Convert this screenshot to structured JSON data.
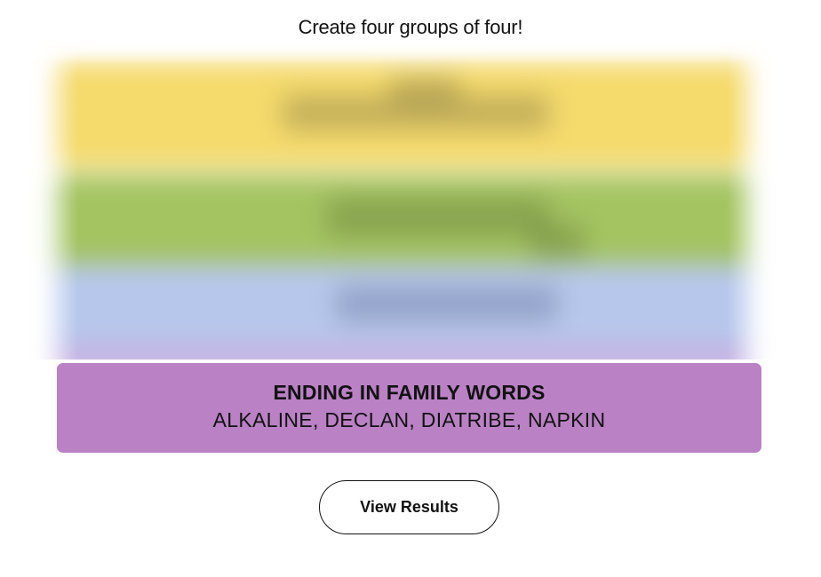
{
  "header": {
    "instructions": "Create four groups of four!"
  },
  "board": {
    "state": "blurred",
    "colors": [
      "#f5da6c",
      "#a4c461",
      "#b7c7ec",
      "#c6b3e3"
    ]
  },
  "solved_group": {
    "title": "ENDING IN FAMILY WORDS",
    "members": "ALKALINE, DECLAN, DIATRIBE, NAPKIN",
    "color": "#ba81c5"
  },
  "actions": {
    "view_results_label": "View Results"
  }
}
